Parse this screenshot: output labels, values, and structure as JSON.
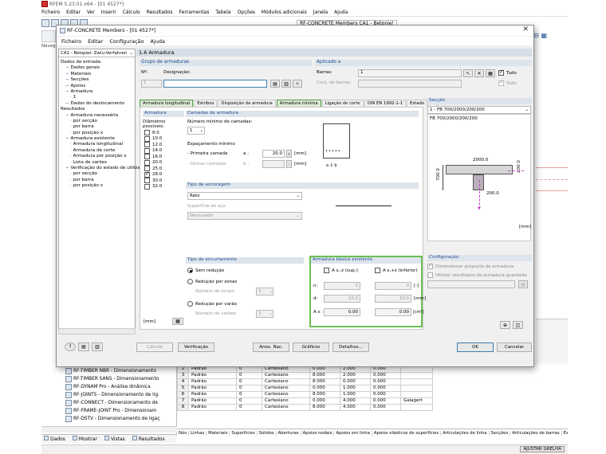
{
  "main": {
    "title": "RFEM 5.23.01 x64 - [01 4527*]",
    "menu": [
      "Ficheiro",
      "Editar",
      "Ver",
      "Inserir",
      "Cálculo",
      "Resultados",
      "Ferramentas",
      "Tabela",
      "Opções",
      "Módulos adicionais",
      "Janela",
      "Ajuda"
    ],
    "toolbar_combo": "RF-CONCRETE Members CA1 - Betonie!",
    "nav_label": "Naveg",
    "nav_items": [
      "RF-TIMBER NBR - Dimensionamento",
      "RF-TIMBER SANS - Dimensionamento",
      "RF-DYNAM Pro - Análise dinâmica",
      "RF-JOINTS - Dimensionamento de lig.",
      "RF-CONNECT - Dimensionamento de",
      "RF-FRAME-JOINT Pro - Dimensionam",
      "RF-DSTV - Dimensionamento de ligaç"
    ],
    "nav_tabs": [
      "Dados",
      "Mostrar",
      "Vistas",
      "Resultados"
    ],
    "grid_rows": [
      [
        "2",
        "Padrão",
        "0",
        "Cartesiano",
        "0.000",
        "2.000",
        "0.000",
        ""
      ],
      [
        "3",
        "Padrão",
        "0",
        "Cartesiano",
        "8.000",
        "2.000",
        "0.000",
        ""
      ],
      [
        "4",
        "Padrão",
        "0",
        "Cartesiano",
        "8.000",
        "0.000",
        "0.000",
        ""
      ],
      [
        "5",
        "Padrão",
        "0",
        "Cartesiano",
        "0.000",
        "1.000",
        "0.000",
        ""
      ],
      [
        "6",
        "Padrão",
        "0",
        "Cartesiano",
        "8.000",
        "1.000",
        "0.000",
        ""
      ],
      [
        "7",
        "Padrão",
        "0",
        "Cartesiano",
        "0.000",
        "4.000",
        "0.000",
        "Galagert"
      ],
      [
        "8",
        "Padrão",
        "0",
        "Cartesiano",
        "8.000",
        "4.000",
        "0.000",
        ""
      ]
    ],
    "bottom_tabs": [
      "Nós",
      "Linhas",
      "Materiais",
      "Superfícies",
      "Sólidos",
      "Aberturas",
      "Apoios nodais",
      "Apoios em linha",
      "Apoios elásticos de superfícies",
      "Articulações de linha",
      "Secções",
      "Articulações de barras",
      "Ex"
    ],
    "status": "AJUSTAR GRELHA"
  },
  "dialog": {
    "title": "RF-CONCRETE Members - [01 4527*]",
    "menu": [
      "Ficheiro",
      "Editar",
      "Configuração",
      "Ajuda"
    ],
    "case_combo": "CA1 - Beispiel: Zwiu-Verfahren",
    "page_title": "1.6 Armadura",
    "tree": [
      {
        "t": "Dados de entrada",
        "l": 0
      },
      {
        "t": "Dados gerais",
        "l": 1
      },
      {
        "t": "Materiais",
        "l": 1
      },
      {
        "t": "Secções",
        "l": 1
      },
      {
        "t": "Apoios",
        "l": 1
      },
      {
        "t": "Armadura",
        "l": 1
      },
      {
        "t": "1",
        "l": 2
      },
      {
        "t": "Dados do deslocamento",
        "l": 1
      },
      {
        "t": "Resultados",
        "l": 0
      },
      {
        "t": "Armadura necessária",
        "l": 1
      },
      {
        "t": "por secção",
        "l": 2
      },
      {
        "t": "por barra",
        "l": 2
      },
      {
        "t": "por posição x",
        "l": 2
      },
      {
        "t": "Armadura existente",
        "l": 1
      },
      {
        "t": "Armadura longitudinal",
        "l": 2
      },
      {
        "t": "Armadura de corte",
        "l": 2
      },
      {
        "t": "Armadura por posição x",
        "l": 2
      },
      {
        "t": "Lista de varões",
        "l": 2
      },
      {
        "t": "Verificação do estado de utilizaç",
        "l": 1
      },
      {
        "t": "por secção",
        "l": 2
      },
      {
        "t": "por barra",
        "l": 2
      },
      {
        "t": "por posição x",
        "l": 2
      }
    ],
    "grupo": {
      "header": "Grupo de armaduras",
      "no_label": "Nº:",
      "no_value": "1",
      "desig_label": "Designação:",
      "desig_value": ""
    },
    "aplicado": {
      "header": "Aplicado a",
      "barras_label": "Barras:",
      "barras_value": "1",
      "conj_label": "Conj. de barras:",
      "tudo1": "Tudo",
      "tudo2": "Tudo"
    },
    "tabs": [
      "Armadura longitudinal",
      "Estribos",
      "Disposição da armadura",
      "Armadura mínima",
      "Ligação de corte",
      "DIN EN 1992-1-1",
      "Estado"
    ],
    "armadura": {
      "header": "Armadura",
      "diam_label": "Diâmetros possíveis:",
      "diams": [
        {
          "v": "8.0",
          "c": false
        },
        {
          "v": "10.0",
          "c": false
        },
        {
          "v": "12.0",
          "c": false
        },
        {
          "v": "14.0",
          "c": false
        },
        {
          "v": "16.0",
          "c": false
        },
        {
          "v": "20.0",
          "c": false
        },
        {
          "v": "25.0",
          "c": false
        },
        {
          "v": "28.0",
          "c": true
        },
        {
          "v": "30.0",
          "c": false
        },
        {
          "v": "32.0",
          "c": false
        }
      ],
      "unit": "[mm]"
    },
    "camadas": {
      "header": "Camadas de armadura",
      "num_label": "Número mínimo de camadas:",
      "num_value": "1",
      "esp_label": "Espaçamento mínimo",
      "primeira": "- Primeira camada",
      "a": "a :",
      "a_value": "20.0",
      "a_unit": "[mm]",
      "outras": "- Outras camadas",
      "b": "b :",
      "b_unit": "[mm]"
    },
    "ancoragem": {
      "header": "Tipo de ancoragem",
      "value": "Reto",
      "sup_label": "Superfície do aço",
      "sup_value": "Nervurado"
    },
    "encurtamento": {
      "header": "Tipo de encurtamento",
      "opt1": "Sem redução",
      "opt2": "Redução por zonas",
      "zonas_label": "Número de zonas:",
      "zonas_value": "3",
      "opt3": "Redução por varão",
      "varoes_label": "Número de varões:",
      "varoes_value": "2"
    },
    "basica": {
      "header": "Armadura básica existente",
      "col1": "A s,-z (sup.):",
      "col2": "A s,+z (inferior)",
      "n_label": "n:",
      "n1": "0",
      "n2": "0",
      "n_unit": "[-]",
      "d_label": "d:",
      "d1": "10.0",
      "d2": "10.0",
      "d_unit": "[mm]",
      "as_label": "A s :",
      "as1": "0.00",
      "as2": "0.00",
      "as_unit": "[cm²]"
    },
    "seccao": {
      "header": "Secção",
      "combo": "1 - FB 700/2000/200/200",
      "name": "FB 700/2000/200/200",
      "dim_top": "2000.0",
      "dim_h": "200.0",
      "dim_left": "700.0",
      "dim_bot": "200.0",
      "unit": "[mm]"
    },
    "config": {
      "header": "Configuração",
      "c1": "Dimensionar proposta de armadura",
      "c2": "Utilizar resultados da armadura guardada"
    },
    "buttons": {
      "calculo": "Cálculo",
      "verificacao": "Verificação",
      "anex": "Anex. Nac.",
      "graficos": "Gráficos",
      "detalhes": "Detalhes...",
      "ok": "OK",
      "cancelar": "Cancelar"
    }
  }
}
